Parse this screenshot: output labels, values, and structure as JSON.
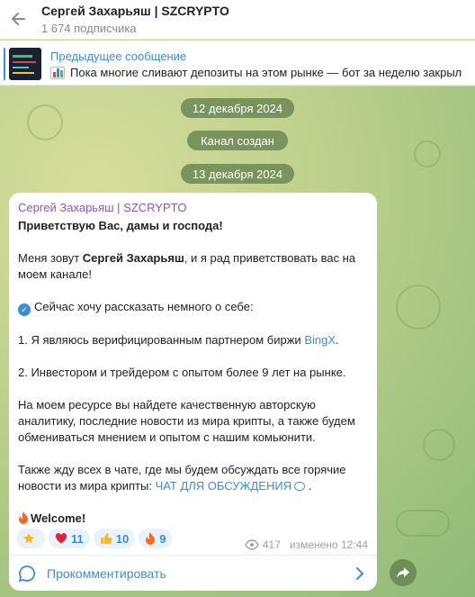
{
  "header": {
    "title": "Сергей Захарьяш | SZCRYPTO",
    "subtitle": "1 674 подписчика"
  },
  "pinned": {
    "title": "Предыдущее сообщение",
    "text": "Пока многие сливают депозиты на этом рынке — бот за неделю закрыл"
  },
  "dates": {
    "date1": "12 декабря 2024",
    "service": "Канал создан",
    "date2": "13 декабря 2024"
  },
  "message": {
    "sender": "Сергей Захарьяш | SZCRYPTO",
    "greeting": "Приветствую Вас, дамы и господа!",
    "intro_pre": "Меня зовут ",
    "intro_name": "Сергей Захарьяш",
    "intro_post": ", и я рад приветствовать вас на моем канале!",
    "about": "Сейчас хочу рассказать немного о себе:",
    "point1_pre": "1. Я являюсь верифицированным партнером биржи ",
    "point1_link": "BingX",
    "point1_post": ".",
    "point2": "2. Инвестором и трейдером с опытом более 9 лет на рынке.",
    "resource": "На моем ресурсе вы найдете качественную авторскую аналитику, последние новости из мира крипты, а также будем обмениваться мнением и опытом с нашим комьюнити.",
    "chat_pre": "Также жду всех в чате, где мы будем обсуждать все горячие новости из мира крипты: ",
    "chat_link": "ЧАТ ДЛЯ ОБСУЖДЕНИЯ",
    "chat_post": " .",
    "welcome": "Welcome!"
  },
  "reactions": [
    {
      "icon": "star-icon",
      "count": ""
    },
    {
      "icon": "heart-icon",
      "count": "11"
    },
    {
      "icon": "thumbs-up-icon",
      "count": "10"
    },
    {
      "icon": "fire-icon",
      "count": "9"
    }
  ],
  "meta": {
    "views": "417",
    "edited": "изменено 12:44"
  },
  "comment": {
    "label": "Прокомментировать"
  },
  "colors": {
    "accent": "#3a8ddb",
    "sender": "#8757c9"
  }
}
